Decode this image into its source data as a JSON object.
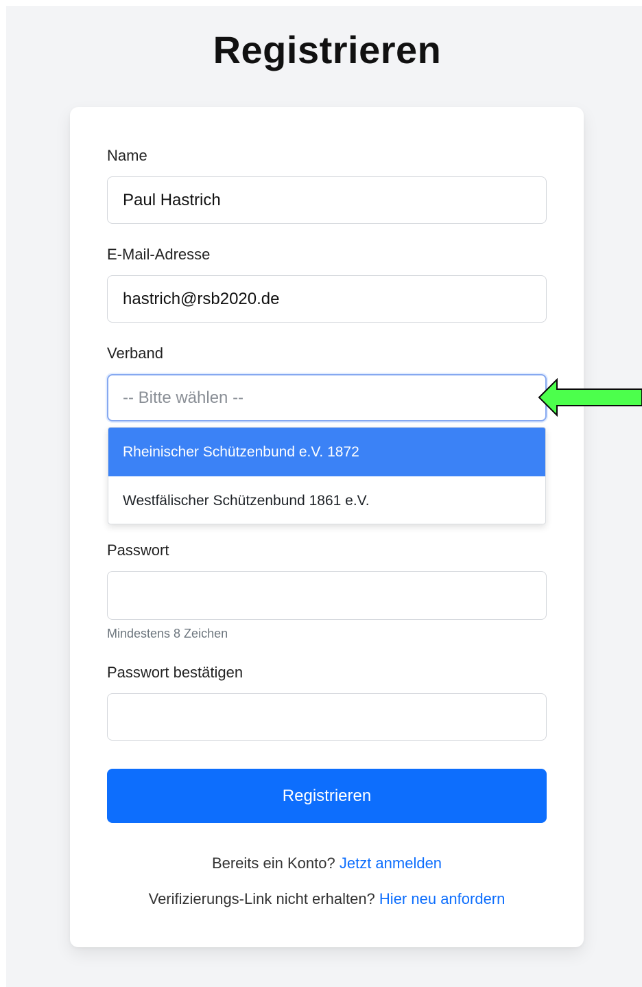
{
  "page": {
    "title": "Registrieren"
  },
  "form": {
    "name": {
      "label": "Name",
      "value": "Paul Hastrich"
    },
    "email": {
      "label": "E-Mail-Adresse",
      "value": "hastrich@rsb2020.de"
    },
    "verband": {
      "label": "Verband",
      "placeholder": "-- Bitte wählen --",
      "options": [
        {
          "label": "Rheinischer Schützenbund e.V. 1872",
          "highlighted": true
        },
        {
          "label": "Westfälischer Schützenbund 1861 e.V.",
          "highlighted": false
        }
      ]
    },
    "password": {
      "label": "Passwort",
      "value": "",
      "help": "Mindestens 8 Zeichen"
    },
    "password_confirm": {
      "label": "Passwort bestätigen",
      "value": ""
    },
    "submit_label": "Registrieren"
  },
  "footer": {
    "login_prompt": "Bereits ein Konto?",
    "login_link": "Jetzt anmelden",
    "verify_prompt": "Verifizierungs-Link nicht erhalten?",
    "verify_link": "Hier neu anfordern"
  },
  "colors": {
    "primary": "#0d6efd",
    "option_highlight": "#3b82f6",
    "annotation_arrow": "#4cff4c"
  },
  "icons": {
    "annotation": "left-arrow-icon"
  }
}
